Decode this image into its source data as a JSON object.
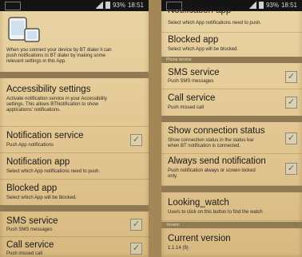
{
  "left": {
    "status_time": "18:51",
    "status_batt": "93%",
    "intro": [
      "When you connect your device by BT dialer it can",
      "push notifications to BT dialer by making some",
      "relevant settings in this App."
    ],
    "items": [
      {
        "title": "Accessibility settings",
        "summary": [
          "Activate notification service in your Accessibility",
          "settings. This allows BTNotification to show",
          "applications' notifications."
        ]
      },
      {
        "title": "Notification service",
        "summary": [
          "Push App notifications"
        ],
        "checked": true
      },
      {
        "title": "Notification app",
        "summary": [
          "Select which App notifications need to push."
        ]
      },
      {
        "title": "Blocked app",
        "summary": [
          "Select which App will be blocked."
        ]
      },
      {
        "title": "SMS service",
        "summary": [
          "Push SMS messages"
        ],
        "checked": true
      },
      {
        "title": "Call service",
        "summary": [
          "Push missed call"
        ],
        "checked": true
      }
    ]
  },
  "right": {
    "status_time": "18:51",
    "status_batt": "93%",
    "cut_title": "Notification app",
    "cut_summary": "Select which App notifications need to push.",
    "headers": [
      "Phone service",
      "",
      "",
      "",
      "Version"
    ],
    "items": [
      {
        "title": "Blocked app",
        "summary": [
          "Select which App will be blocked."
        ]
      },
      {
        "title": "SMS service",
        "summary": [
          "Push SMS messages"
        ],
        "checked": true
      },
      {
        "title": "Call service",
        "summary": [
          "Push missed call"
        ],
        "checked": true
      },
      {
        "title": "Show connection status",
        "summary": [
          "Show connection status in the status bar",
          "when BT notification is connected."
        ],
        "checked": true
      },
      {
        "title": "Always send notification",
        "summary": [
          "Push notification always or screen locked",
          "only."
        ],
        "checked": true
      },
      {
        "title": "Looking_watch",
        "summary": [
          "Users to click on this button to find the watch"
        ]
      },
      {
        "title": "Current version",
        "summary": [
          "1.1.14 (9)"
        ]
      }
    ]
  }
}
